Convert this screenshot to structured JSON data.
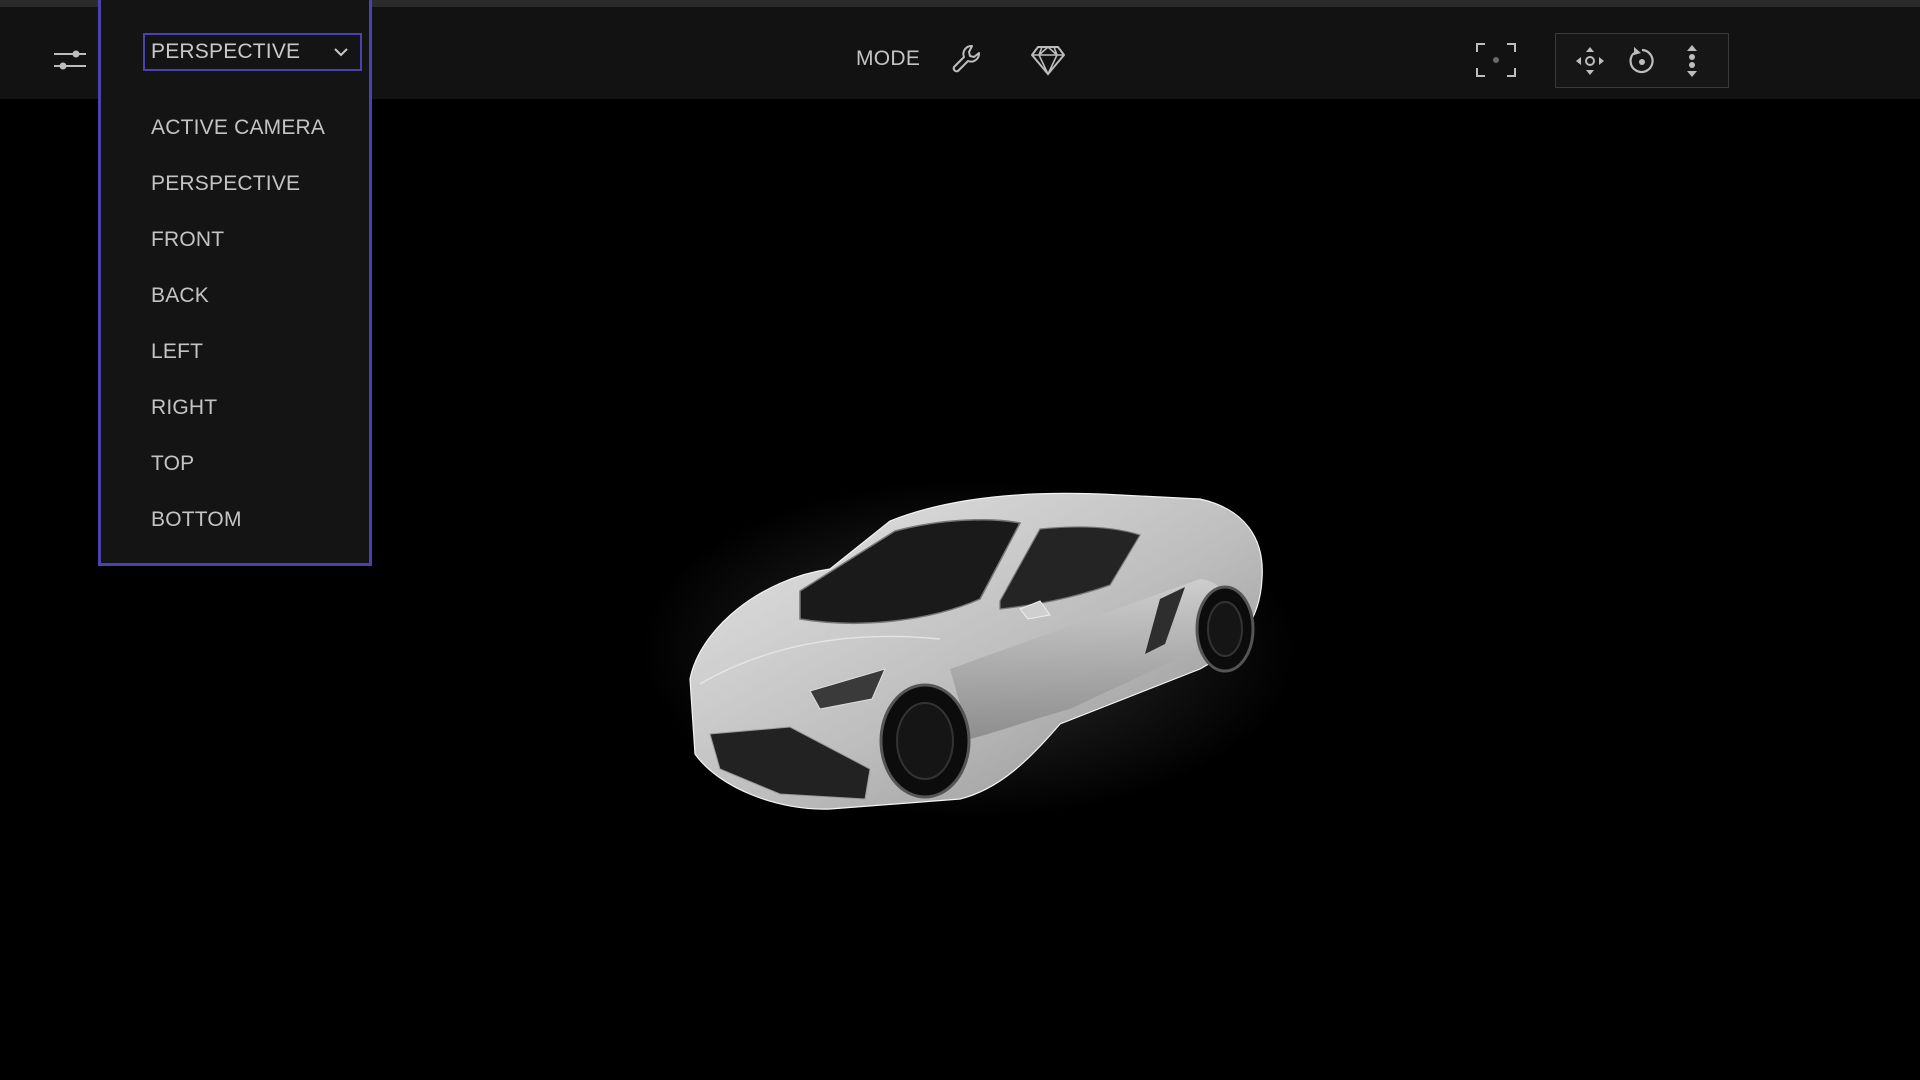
{
  "toolbar": {
    "settings_icon": "sliders-icon",
    "view_select": {
      "selected": "PERSPECTIVE",
      "icon": "chevron-down-icon"
    },
    "mode_label": "MODE",
    "mode_tools": [
      {
        "name": "wrench-icon"
      },
      {
        "name": "diamond-icon"
      }
    ],
    "fit_icon": "frame-icon",
    "navigation": [
      {
        "name": "pan-icon"
      },
      {
        "name": "orbit-icon"
      },
      {
        "name": "dolly-icon"
      }
    ]
  },
  "dropdown": {
    "options": [
      "ACTIVE CAMERA",
      "PERSPECTIVE",
      "FRONT",
      "BACK",
      "LEFT",
      "RIGHT",
      "TOP",
      "BOTTOM"
    ]
  },
  "viewport": {
    "model": "sports-car-model"
  },
  "colors": {
    "accent": "#4b42b0",
    "toolbar_bg": "#121212",
    "viewport_bg": "#000000",
    "text": "#c4c4c4"
  }
}
